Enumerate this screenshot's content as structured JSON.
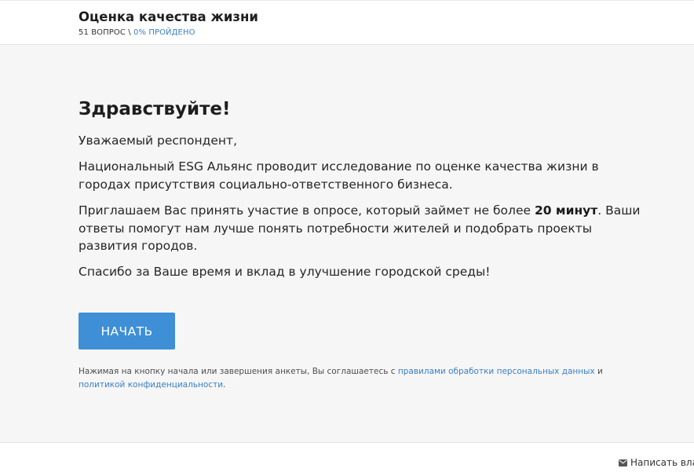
{
  "header": {
    "title": "Оценка качества жизни",
    "question_count": "51 ВОПРОС",
    "separator": " \\ ",
    "progress": "0% ПРОЙДЕНО"
  },
  "intro": {
    "greeting": "Здравствуйте!",
    "salutation": "Уважаемый респондент,",
    "paragraph_research": "Национальный ESG Альянс проводит исследование по оценке качества жизни в городах присутствия социально-ответственного бизнеса.",
    "invite_before": "Приглашаем Вас принять участие в опросе, который займет не более ",
    "invite_duration": "20 минут",
    "invite_after": ". Ваши ответы помогут нам лучше понять потребности жителей и подобрать проекты развития городов.",
    "thanks": "Спасибо за Ваше время и вклад в улучшение городской среды!"
  },
  "actions": {
    "start_label": "НАЧАТЬ"
  },
  "consent": {
    "text_before": "Нажимая на кнопку начала или завершения анкеты, Вы соглашаетесь с ",
    "link_personal_data": "правилами обработки персональных данных",
    "text_middle": " и ",
    "link_privacy": "политикой конфиденциальности",
    "text_after": "."
  },
  "footer": {
    "write_label": "Написать вла",
    "icon": "mail-icon"
  },
  "colors": {
    "accent": "#3e8fd6",
    "link": "#3a7fc4",
    "content_bg": "#f6f6f6"
  }
}
